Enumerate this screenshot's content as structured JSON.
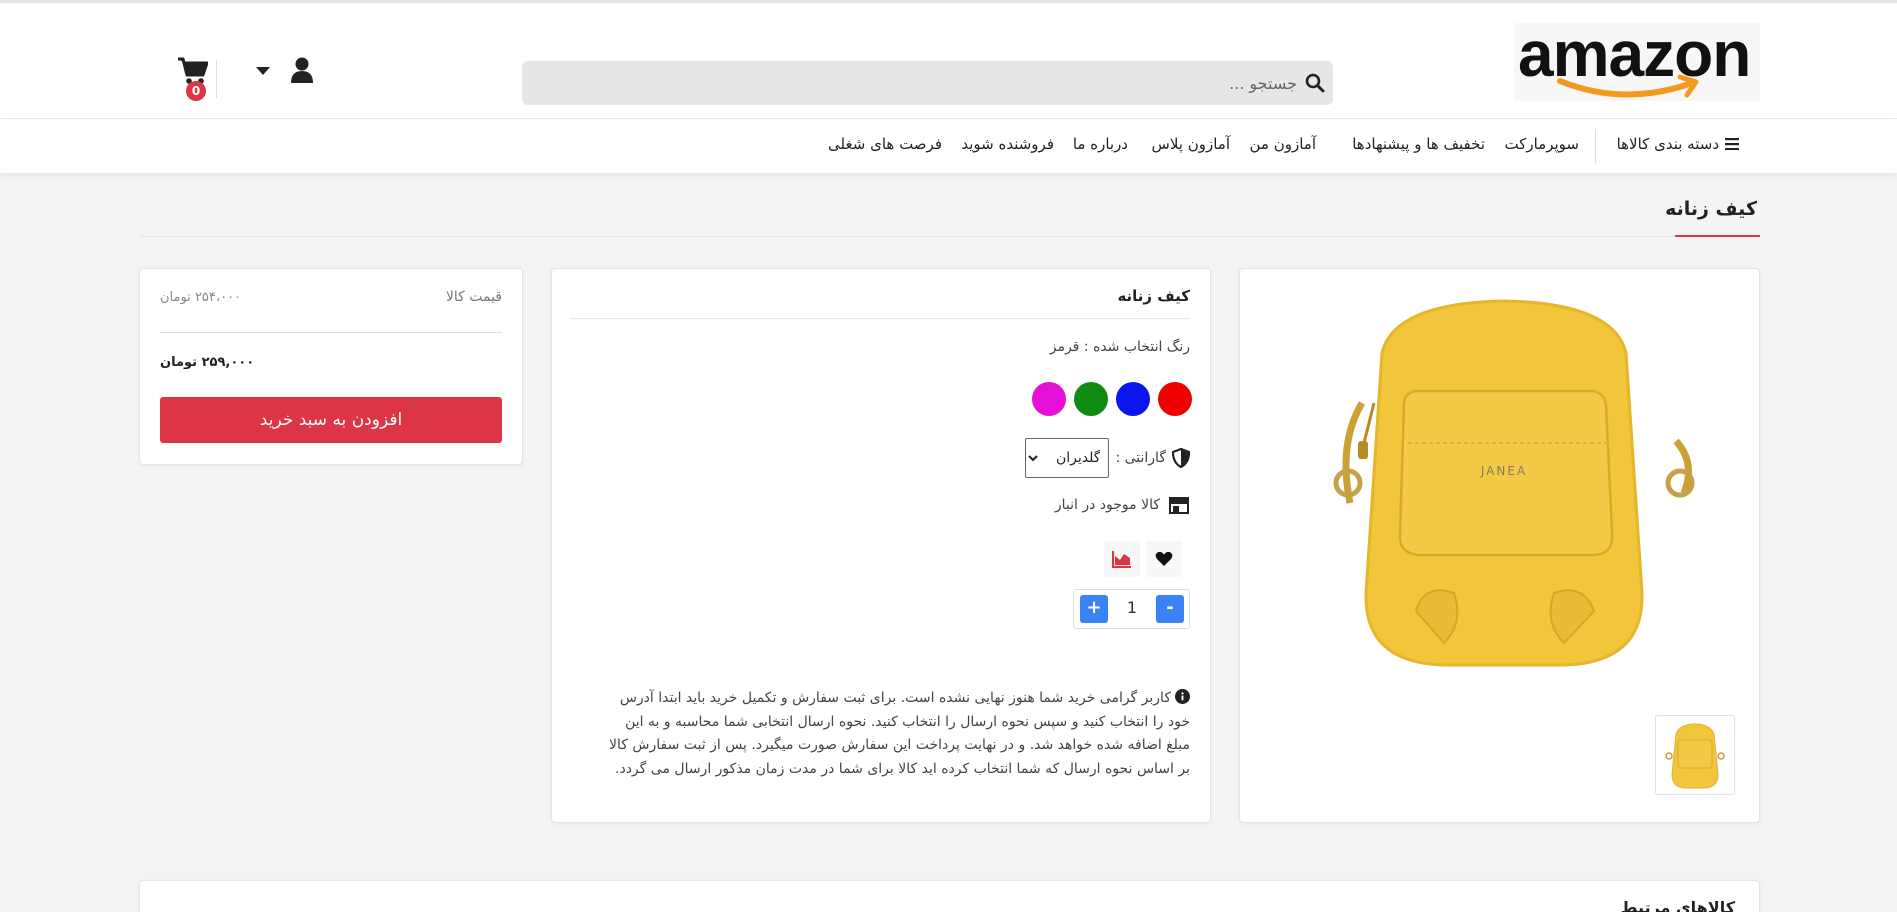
{
  "header": {
    "logo_text": "amazon",
    "search_placeholder": "جستجو ...",
    "cart_count": "0"
  },
  "nav": {
    "categories_label": "دسته بندی کالاها",
    "items": [
      "سوپرمارکت",
      "تخفیف ها و پیشنهادها",
      "آمازون من",
      "آمازون پلاس",
      "درباره ما",
      "فروشنده شوید",
      "فرصت های شغلی"
    ]
  },
  "page": {
    "title": "کیف زنانه"
  },
  "product": {
    "name": "کیف زنانه",
    "brand_on_image": "JANEA",
    "selected_color_label": "رنگ انتخاب شده : قرمز",
    "colors": [
      "#ee0000",
      "#0b16ee",
      "#0f8a12",
      "#e50fd6"
    ],
    "warranty_label": "گارانتی :",
    "warranty_selected": "گلدیران",
    "stock_label": "کالا موجود در انبار",
    "quantity": "1",
    "qty_plus": "+",
    "qty_minus": "-",
    "notice_lines": [
      "کاربر گرامی خرید شما هنوز نهایی نشده است. برای ثبت سفارش و تکمیل خرید باید ابتدا آدرس",
      "خود را انتخاب کنید و سپس نحوه ارسال را انتخاب کنید. نحوه ارسال انتخابی شما محاسبه و به این",
      "مبلغ اضافه شده خواهد شد. و در نهایت پرداخت این سفارش صورت میگیرد. پس از ثبت سفارش کالا",
      "بر اساس نحوه ارسال که شما انتخاب کرده اید کالا برای شما در مدت زمان مذکور ارسال می گردد."
    ]
  },
  "price": {
    "label": "قیمت کالا",
    "old": "۲۵۴،۰۰۰ تومان",
    "final": "۲۵۹,۰۰۰ تومان",
    "add_to_cart": "افزودن به سبد خرید"
  },
  "related": {
    "title": "کالاهای مرتبط"
  },
  "colors": {
    "accent_red": "#dc3545",
    "blue": "#3b82f6",
    "bag_yellow": "#f2c63a"
  }
}
